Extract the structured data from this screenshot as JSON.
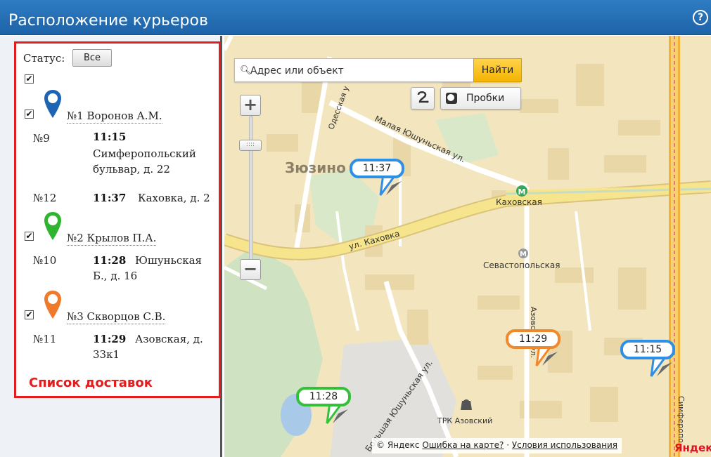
{
  "window": {
    "title": "Расположение курьеров",
    "help_icon": "?"
  },
  "sidebar": {
    "status_label": "Статус:",
    "status_button": "Все",
    "caption": "Список доставок",
    "couriers": [
      {
        "name": "№1 Воронов А.М.",
        "color": "#1e64b4",
        "orders": [
          {
            "no": "№9",
            "time": "11:15",
            "address": "Симферопольский бульвар, д. 22"
          },
          {
            "no": "№12",
            "time": "11:37",
            "address": "Каховка, д. 2"
          }
        ]
      },
      {
        "name": "№2 Крылов П.А.",
        "color": "#2fb42f",
        "orders": [
          {
            "no": "№10",
            "time": "11:28",
            "address": "Юшуньская Б., д. 16"
          }
        ]
      },
      {
        "name": "№3 Скворцов С.В.",
        "color": "#f07a2c",
        "orders": [
          {
            "no": "№11",
            "time": "11:29",
            "address": "Азовская, д. 33к1"
          }
        ]
      }
    ]
  },
  "map": {
    "search_placeholder": "Адрес или объект",
    "find_button": "Найти",
    "traffic_button": "Пробки",
    "route_icon": "route-icon",
    "zoom_in": "+",
    "zoom_out": "−",
    "labels": {
      "district": "Зюзино",
      "metro1": "Каховская",
      "metro2": "Севастопольская",
      "street_kakhovka": "ул. Каховка",
      "street_malaya": "Малая Юшуньская ул.",
      "street_bolshaya": "Большая Юшуньская ул.",
      "street_odesskaya": "Одесская у",
      "street_azov": "Азовская ул.",
      "street_simf": "Симферопо",
      "mall": "ТРК Азовский",
      "yandex_partial": "Яндекс"
    },
    "markers": [
      {
        "time": "11:37",
        "color": "#2f8fe5"
      },
      {
        "time": "11:28",
        "color": "#35c03a"
      },
      {
        "time": "11:29",
        "color": "#f0892c"
      },
      {
        "time": "11:15",
        "color": "#2f8fe5"
      }
    ],
    "copyright": "© Яндекс",
    "error_link": "Ошибка на карте?",
    "terms_link": "Условия использования"
  }
}
